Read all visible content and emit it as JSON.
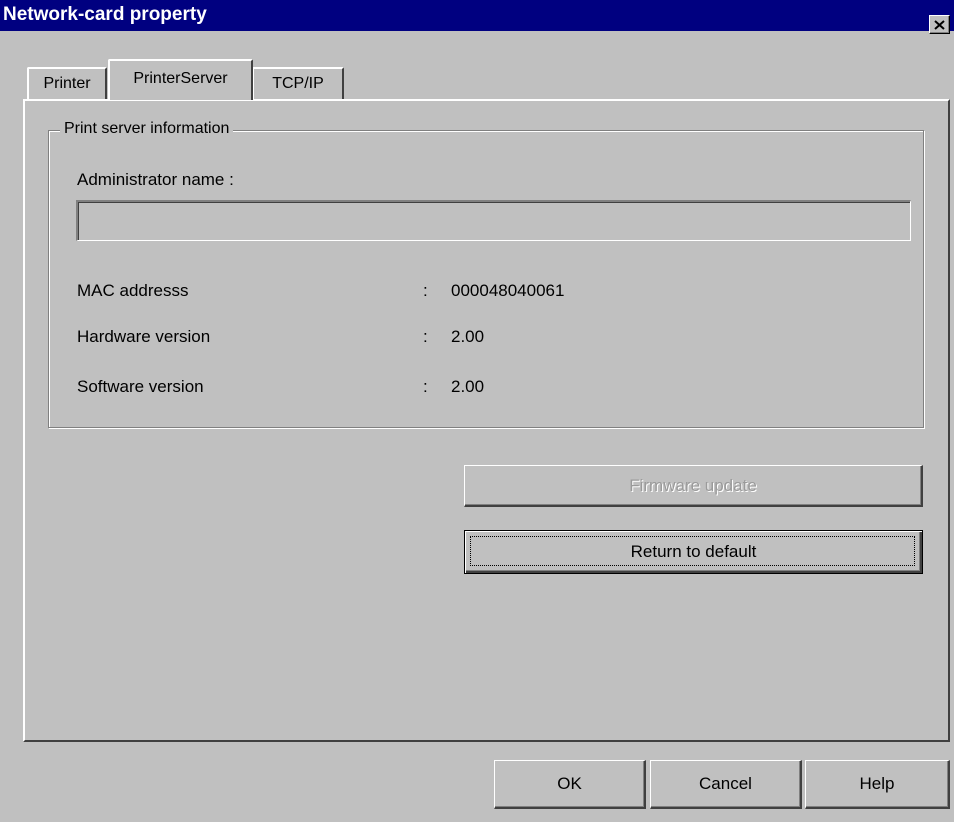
{
  "window": {
    "title": "Network-card property"
  },
  "tabs": [
    {
      "label": "Printer",
      "selected": false
    },
    {
      "label": "PrinterServer",
      "selected": true
    },
    {
      "label": "TCP/IP",
      "selected": false
    }
  ],
  "group": {
    "legend": "Print server information",
    "admin_label": "Administrator name :",
    "admin_value": "",
    "rows": [
      {
        "label": "MAC addresss",
        "sep": ":",
        "value": "000048040061"
      },
      {
        "label": "Hardware version",
        "sep": ":",
        "value": "2.00"
      },
      {
        "label": "Software version",
        "sep": ":",
        "value": "2.00"
      }
    ]
  },
  "actions": {
    "firmware_update": {
      "label": "Firmware update",
      "enabled": false
    },
    "return_default": {
      "label": "Return to default",
      "enabled": true
    }
  },
  "footer": {
    "ok": "OK",
    "cancel": "Cancel",
    "help": "Help"
  }
}
